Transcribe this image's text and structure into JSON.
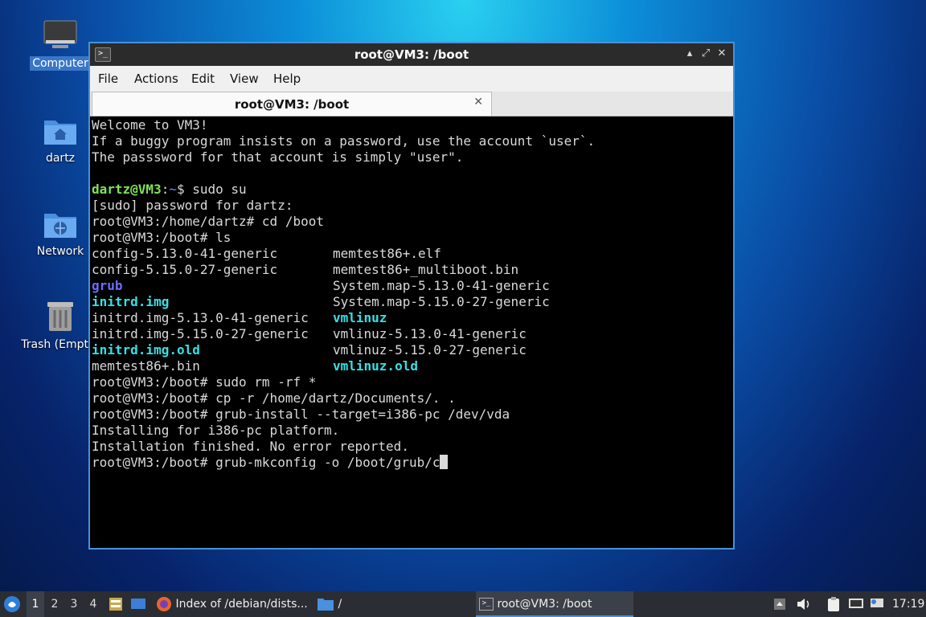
{
  "desktop": {
    "icons": [
      {
        "label": "Computer"
      },
      {
        "label": "dartz"
      },
      {
        "label": "Network"
      },
      {
        "label": "Trash (Empty)"
      }
    ]
  },
  "window": {
    "title": "root@VM3: /boot",
    "menu": [
      "File",
      "Actions",
      "Edit",
      "View",
      "Help"
    ],
    "tab_title": "root@VM3: /boot",
    "controls": {
      "minimize": "▴",
      "maximize": "⤢",
      "close": "✕"
    }
  },
  "terminal": {
    "lines": [
      "Welcome to VM3!",
      "If a buggy program insists on a password, use the account `user`.",
      "The passsword for that account is simply \"user\".",
      "",
      "[sudo] password for dartz:",
      "root@VM3:/home/dartz# cd /boot",
      "root@VM3:/boot# ls",
      "root@VM3:/boot# sudo rm -rf *",
      "root@VM3:/boot# cp -r /home/dartz/Documents/. .",
      "root@VM3:/boot# grub-install --target=i386-pc /dev/vda",
      "Installing for i386-pc platform.",
      "Installation finished. No error reported.",
      "root@VM3:/boot# grub-mkconfig -o /boot/grub/c"
    ],
    "prompt_user": "dartz@VM3",
    "prompt_sep": ":",
    "prompt_path": "~",
    "prompt_end": "$ ",
    "prompt_cmd": "sudo su",
    "ls_rows": [
      [
        "config-5.13.0-41-generic",
        "memtest86+.elf"
      ],
      [
        "config-5.15.0-27-generic",
        "memtest86+_multiboot.bin"
      ],
      [
        "grub",
        "System.map-5.13.0-41-generic"
      ],
      [
        "initrd.img",
        "System.map-5.15.0-27-generic"
      ],
      [
        "initrd.img-5.13.0-41-generic",
        "vmlinuz"
      ],
      [
        "initrd.img-5.15.0-27-generic",
        "vmlinuz-5.13.0-41-generic"
      ],
      [
        "initrd.img.old",
        "vmlinuz-5.15.0-27-generic"
      ],
      [
        "memtest86+.bin",
        "vmlinuz.old"
      ]
    ]
  },
  "taskbar": {
    "workspaces": [
      "1",
      "2",
      "3",
      "4"
    ],
    "tasks": [
      "Index of /debian/dists...",
      "/",
      "root@VM3: /boot"
    ],
    "clock": "17:19"
  }
}
